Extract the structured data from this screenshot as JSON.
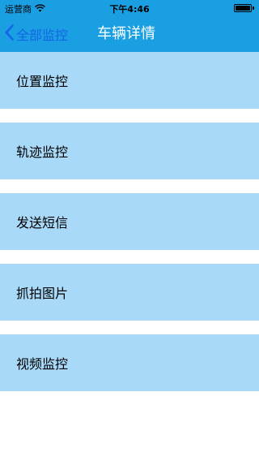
{
  "status_bar": {
    "carrier": "运营商",
    "time": "下午4:46"
  },
  "nav": {
    "back_label": "全部监控",
    "title": "车辆详情"
  },
  "menu": {
    "items": [
      {
        "label": "位置监控"
      },
      {
        "label": "轨迹监控"
      },
      {
        "label": "发送短信"
      },
      {
        "label": "抓拍图片"
      },
      {
        "label": "视频监控"
      }
    ]
  },
  "colors": {
    "nav_background": "#1a9fe3",
    "back_tint": "#1565e6",
    "item_background": "#a8d9f8"
  }
}
